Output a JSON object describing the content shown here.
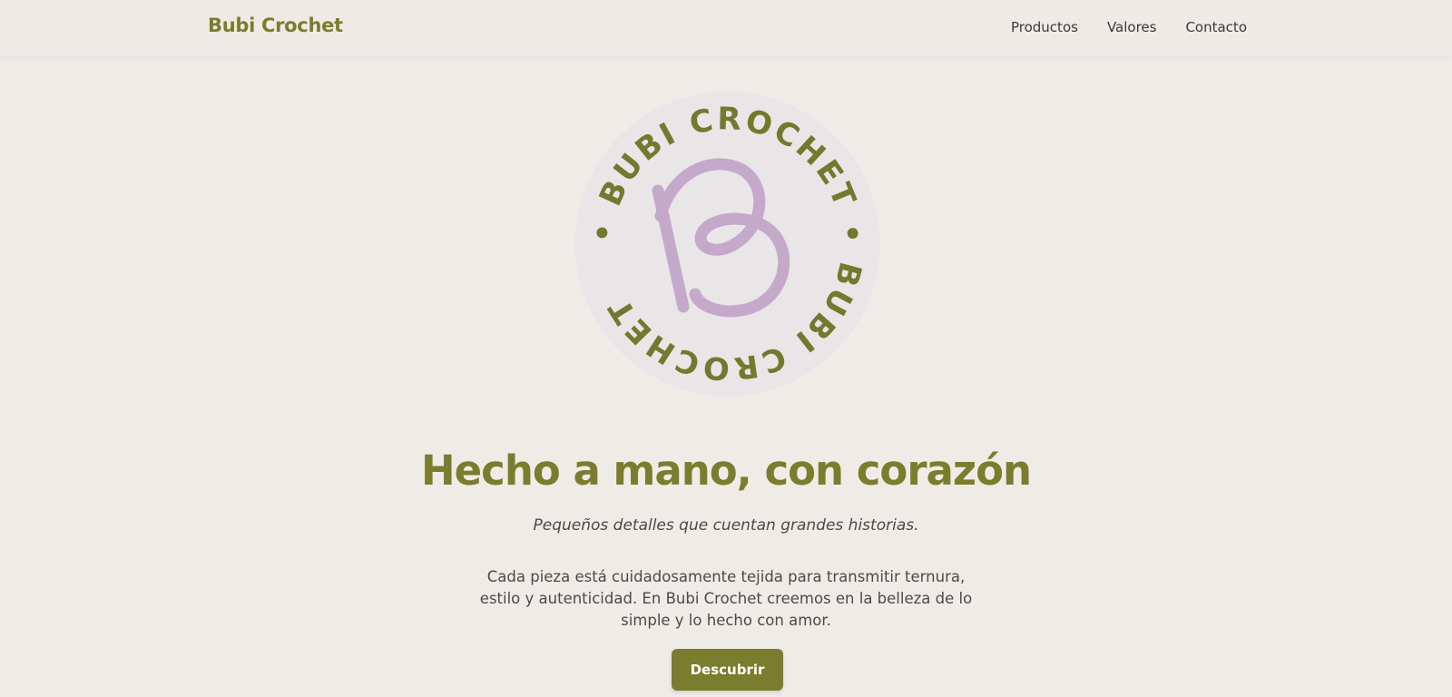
{
  "navbar": {
    "brand": "Bubi Crochet",
    "links": [
      "Productos",
      "Valores",
      "Contacto"
    ]
  },
  "logo": {
    "ring_text": "• BUBI CROCHET • BUBI CROCHET",
    "icon": "b-letter-yarn-icon",
    "colors": {
      "ring_text": "#717a2d",
      "letter": "#c5a9cb",
      "badge_bg": "#e9e6e8"
    }
  },
  "hero": {
    "title": "Hecho a mano, con corazón",
    "subtitle": "Pequeños detalles que cuentan grandes historias.",
    "body_lines": [
      "Cada pieza está cuidadosamente tejida para transmitir ternura,",
      "estilo y autenticidad. En Bubi Crochet creemos en la belleza de lo",
      "simple y lo hecho con amor."
    ],
    "cta_label": "Descubrir"
  },
  "theme": {
    "background": "#efece8",
    "accent": "#7a7d2d",
    "text": "#4a4a46"
  }
}
